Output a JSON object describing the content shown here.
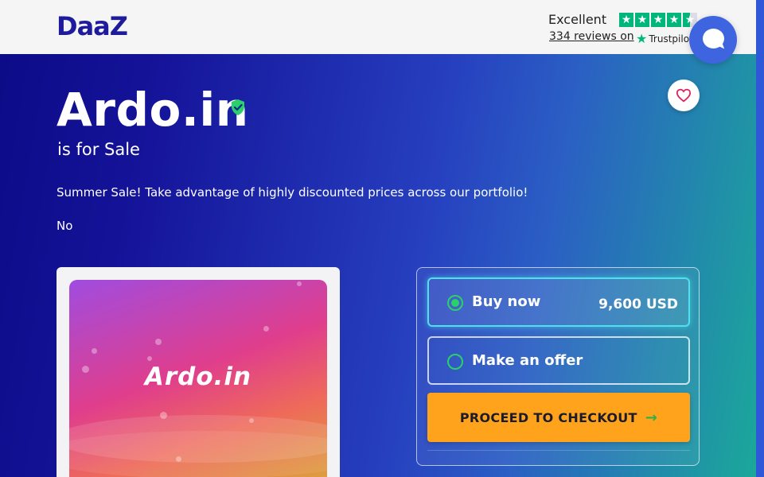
{
  "brand": {
    "logo": "DaaZ"
  },
  "trustpilot": {
    "rating_label": "Excellent",
    "stars": 4.5,
    "reviews_link": "334 reviews on",
    "logo_text": "Trustpilot"
  },
  "listing": {
    "domain": "Ardo.in",
    "subtitle": "is for Sale",
    "promo": "Summer Sale! Take advantage of highly discounted prices across our portfolio!",
    "note": "No",
    "preview_text": "Ardo.in"
  },
  "purchase": {
    "buy_now_label": "Buy now",
    "buy_now_price": "9,600 USD",
    "offer_label": "Make an offer",
    "checkout_label": "PROCEED TO CHECKOUT"
  },
  "colors": {
    "brand": "#1e1b9c",
    "trustpilot_green": "#00b67a",
    "checkout": "#ffa31c",
    "radio": "#2bd06a",
    "chat": "#3f64e0"
  },
  "icons": {
    "verified": "shield-check-icon",
    "favorite": "heart-icon",
    "chat": "chat-bubble-icon",
    "checkout_arrow": "arrow-right-icon"
  }
}
